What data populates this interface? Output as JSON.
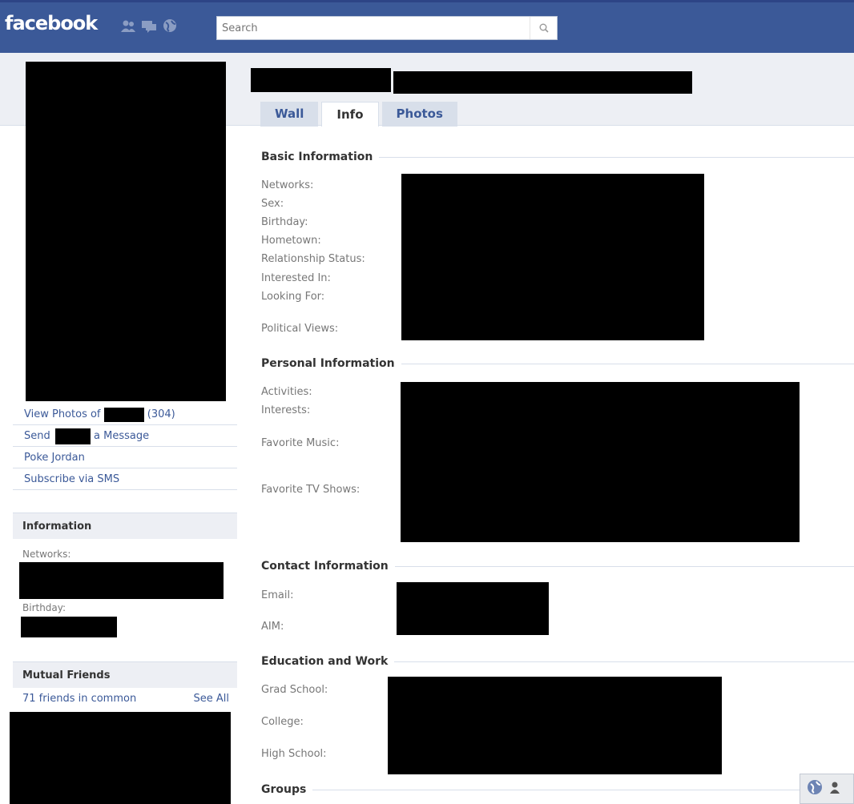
{
  "header": {
    "logo": "facebook",
    "search_placeholder": "Search"
  },
  "tabs": [
    {
      "label": "Wall"
    },
    {
      "label": "Info"
    },
    {
      "label": "Photos"
    }
  ],
  "left_links": {
    "view_photos_prefix": "View Photos of",
    "view_photos_count": "(304)",
    "send_prefix": "Send",
    "send_suffix": "a Message",
    "poke": "Poke Jordan",
    "subscribe": "Subscribe via SMS"
  },
  "information_box": {
    "title": "Information",
    "networks_label": "Networks:",
    "birthday_label": "Birthday:"
  },
  "mutual_friends": {
    "title": "Mutual Friends",
    "count_text": "71 friends in common",
    "see_all": "See All"
  },
  "sections": {
    "basic": {
      "title": "Basic Information",
      "labels": [
        "Networks:",
        "Sex:",
        "Birthday:",
        "Hometown:",
        "Relationship Status:",
        "Interested In:",
        "Looking For:",
        "Political Views:"
      ]
    },
    "personal": {
      "title": "Personal Information",
      "labels": [
        "Activities:",
        "Interests:",
        "Favorite Music:",
        "Favorite TV Shows:"
      ]
    },
    "contact": {
      "title": "Contact Information",
      "labels": [
        "Email:",
        "AIM:"
      ]
    },
    "education": {
      "title": "Education and Work",
      "labels": [
        "Grad School:",
        "College:",
        "High School:"
      ]
    },
    "groups": {
      "title": "Groups"
    }
  },
  "colors": {
    "brand_blue": "#3b5998",
    "band_grey": "#edeff4",
    "border": "#d8dfea"
  }
}
